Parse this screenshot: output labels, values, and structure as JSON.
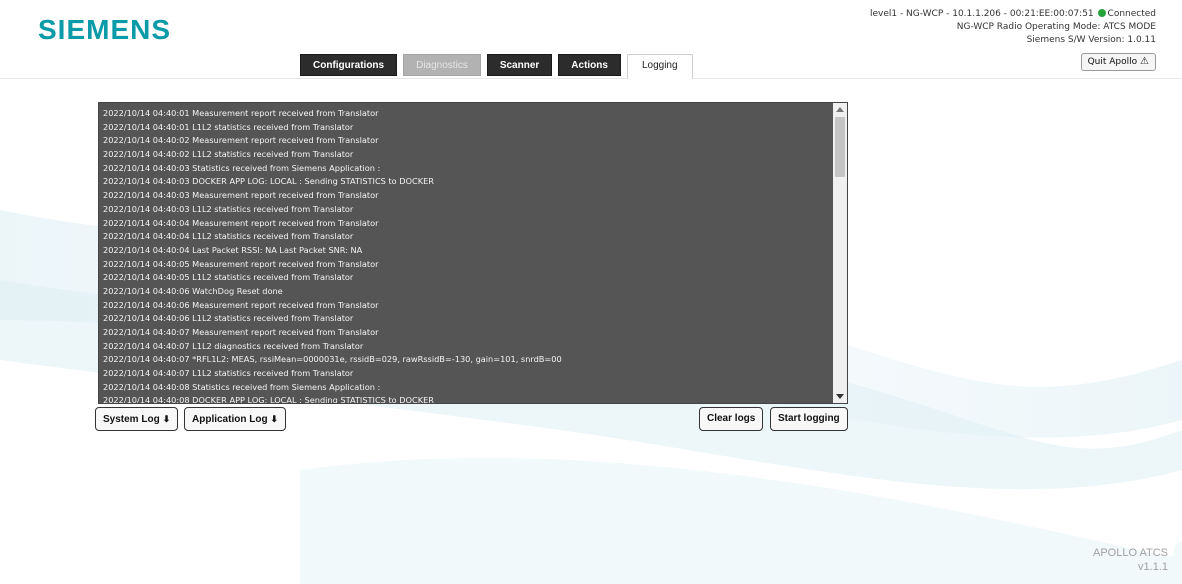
{
  "logo": "SIEMENS",
  "status": {
    "line1_prefix": "level1 - NG-WCP - 10.1.1.206 - 00:21:EE:00:07:51",
    "connection": "Connected",
    "line2": "NG-WCP Radio Operating Mode: ATCS MODE",
    "line3": "Siemens S/W Version: 1.0.11",
    "connected_color": "#27a33a"
  },
  "quit_button": {
    "label": "Quit Apollo",
    "icon": "warning-icon"
  },
  "tabs": [
    {
      "label": "Configurations",
      "state": "normal"
    },
    {
      "label": "Diagnostics",
      "state": "disabled"
    },
    {
      "label": "Scanner",
      "state": "normal"
    },
    {
      "label": "Actions",
      "state": "normal"
    },
    {
      "label": "Logging",
      "state": "active"
    }
  ],
  "log_lines": [
    "2022/10/14 04:40:01  Measurement report received from Translator",
    "2022/10/14 04:40:01  L1L2 statistics received from Translator",
    "2022/10/14 04:40:02  Measurement report received from Translator",
    "2022/10/14 04:40:02  L1L2 statistics received from Translator",
    "2022/10/14 04:40:03  Statistics received from Siemens Application :",
    "2022/10/14 04:40:03  DOCKER APP LOG: LOCAL : Sending STATISTICS to DOCKER",
    "2022/10/14 04:40:03  Measurement report received from Translator",
    "2022/10/14 04:40:03  L1L2 statistics received from Translator",
    "2022/10/14 04:40:04  Measurement report received from Translator",
    "2022/10/14 04:40:04  L1L2 statistics received from Translator",
    "2022/10/14 04:40:04  Last Packet RSSI: NA Last Packet SNR: NA",
    "2022/10/14 04:40:05  Measurement report received from Translator",
    "2022/10/14 04:40:05  L1L2 statistics received from Translator",
    "2022/10/14 04:40:06  WatchDog Reset done",
    "2022/10/14 04:40:06  Measurement report received from Translator",
    "2022/10/14 04:40:06  L1L2 statistics received from Translator",
    "2022/10/14 04:40:07  Measurement report received from Translator",
    "2022/10/14 04:40:07  L1L2 diagnostics received from Translator",
    "2022/10/14 04:40:07  *RFL1L2: MEAS, rssiMean=0000031e, rssidB=029, rawRssidB=-130, gain=101, snrdB=00",
    "2022/10/14 04:40:07  L1L2 statistics received from Translator",
    "2022/10/14 04:40:08  Statistics received from Siemens Application :",
    "2022/10/14 04:40:08  DOCKER APP LOG: LOCAL : Sending STATISTICS to DOCKER"
  ],
  "buttons": {
    "system_log": "System Log",
    "application_log": "Application Log",
    "clear_logs": "Clear logs",
    "start_logging": "Start logging"
  },
  "version": {
    "line1": "APOLLO ATCS",
    "line2": "v1.1.1"
  },
  "colors": {
    "brand": "#0b9aa8",
    "log_bg": "#555555"
  }
}
